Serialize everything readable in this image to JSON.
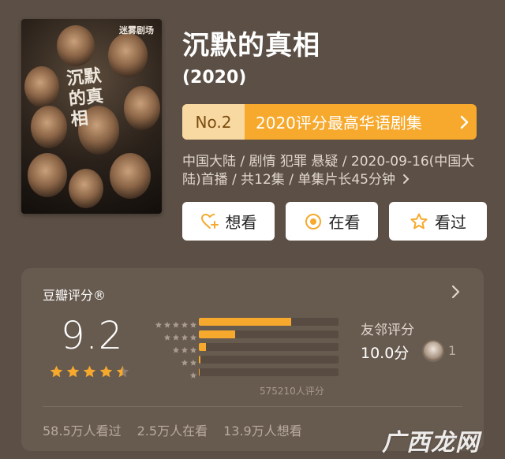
{
  "poster": {
    "brand": "迷雾剧场",
    "title": "沉默的真相"
  },
  "header": {
    "title": "沉默的真相",
    "year": "(2020)"
  },
  "rank": {
    "number": "No.2",
    "text": "2020评分最高华语剧集"
  },
  "info": "中国大陆 / 剧情 犯罪 悬疑 / 2020-09-16(中国大陆)首播 / 共12集 / 单集片长45分钟",
  "actions": {
    "want": "想看",
    "watching": "在看",
    "watched": "看过"
  },
  "rating": {
    "label": "豆瓣评分®",
    "score": "9.2",
    "stars": 4.5,
    "distribution": [
      {
        "stars": 5,
        "fraction": 0.66
      },
      {
        "stars": 4,
        "fraction": 0.26
      },
      {
        "stars": 3,
        "fraction": 0.05
      },
      {
        "stars": 2,
        "fraction": 0.01
      },
      {
        "stars": 1,
        "fraction": 0.005
      }
    ],
    "count": "575210人评分"
  },
  "friends": {
    "label": "友邻评分",
    "score": "10.0分",
    "count": "1"
  },
  "stats": {
    "watched": "58.5万人看过",
    "watching": "2.5万人在看",
    "want": "13.9万人想看"
  },
  "watermark": "广西龙网",
  "colors": {
    "accent": "#f6a92c",
    "background": "#5c5046",
    "card": "#675a4f"
  }
}
